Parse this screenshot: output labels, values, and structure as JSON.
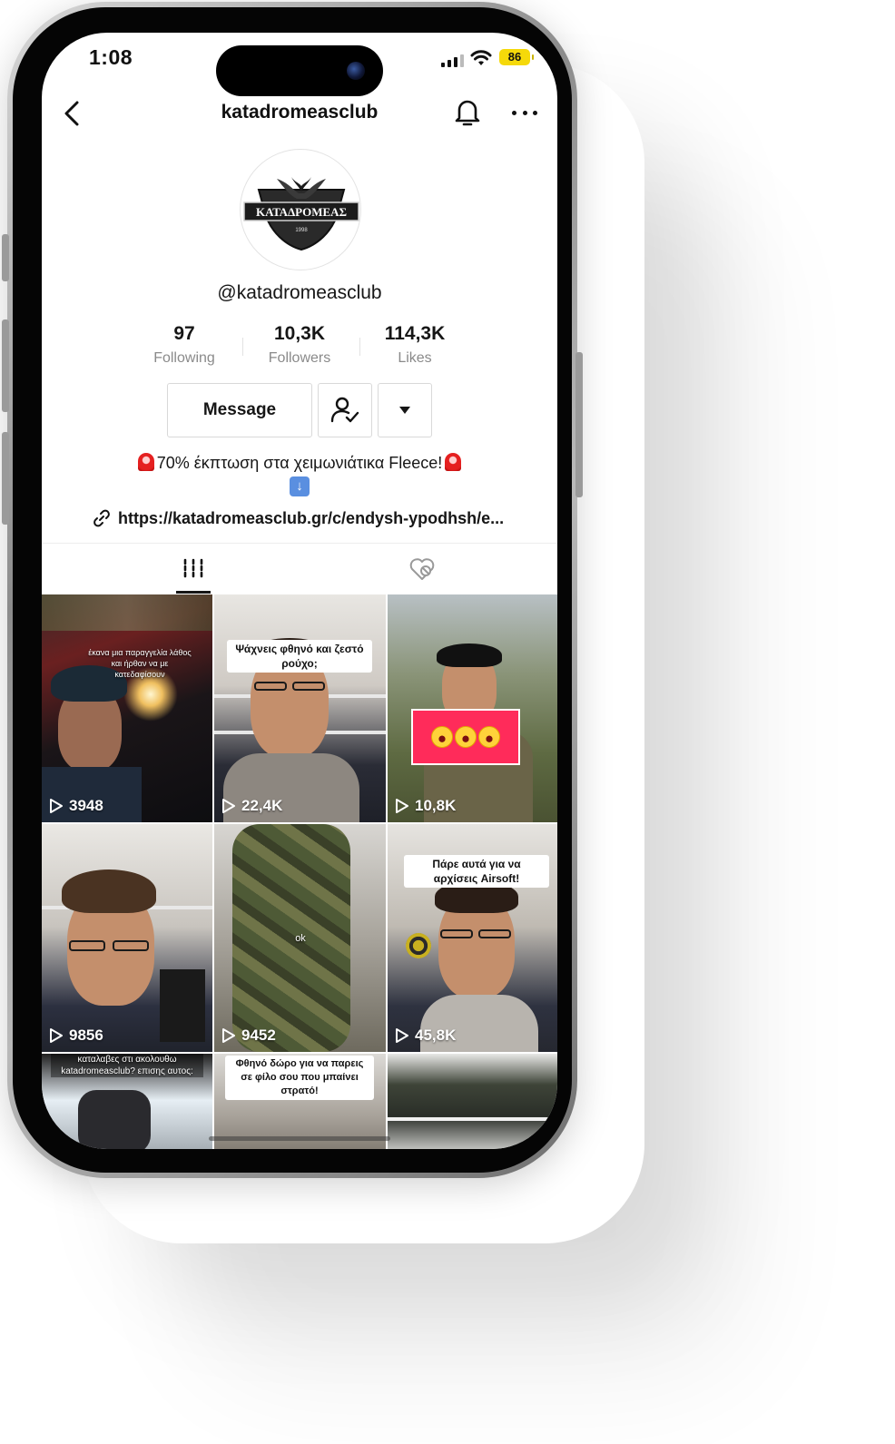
{
  "status_bar": {
    "time": "1:08",
    "battery": "86"
  },
  "header": {
    "title": "katadromeasclub"
  },
  "profile": {
    "logo_text": "ΚΑΤΑΔΡΟΜΕΑΣ",
    "logo_year": "1998",
    "handle": "@katadromeasclub",
    "stats": [
      {
        "value": "97",
        "label": "Following"
      },
      {
        "value": "10,3K",
        "label": "Followers"
      },
      {
        "value": "114,3K",
        "label": "Likes"
      }
    ],
    "message_label": "Message",
    "bio": "70% έκπτωση στα χειμωνιάτικα Fleece!",
    "link": "https://katadromeasclub.gr/c/endysh-ypodhsh/e..."
  },
  "tabs": [
    {
      "icon": "videos-grid-icon"
    },
    {
      "icon": "liked-hidden-icon"
    }
  ],
  "videos": [
    {
      "views": "3948",
      "caption": "έκανα μια παραγγελία λάθος και ήρθαν να με κατεδαφίσουν"
    },
    {
      "views": "22,4K",
      "caption": "Ψάχνεις φθηνό και ζεστό ρούχο;"
    },
    {
      "views": "10,8K",
      "caption": ""
    },
    {
      "views": "9856",
      "caption": ""
    },
    {
      "views": "9452",
      "caption": "ok"
    },
    {
      "views": "45,8K",
      "caption": "Πάρε αυτά για να αρχίσεις Airsoft!"
    },
    {
      "views": "",
      "caption": "καταλαβες στι ακολουθω katadromeasclub? επισης αυτος:"
    },
    {
      "views": "",
      "caption": "Φθηνό δώρο για να παρεις σε φίλο σου που μπαίνει στρατό!"
    },
    {
      "views": "",
      "caption": ""
    }
  ],
  "colors": {
    "accent": "#ff2b5a",
    "battery": "#f5d90a"
  }
}
